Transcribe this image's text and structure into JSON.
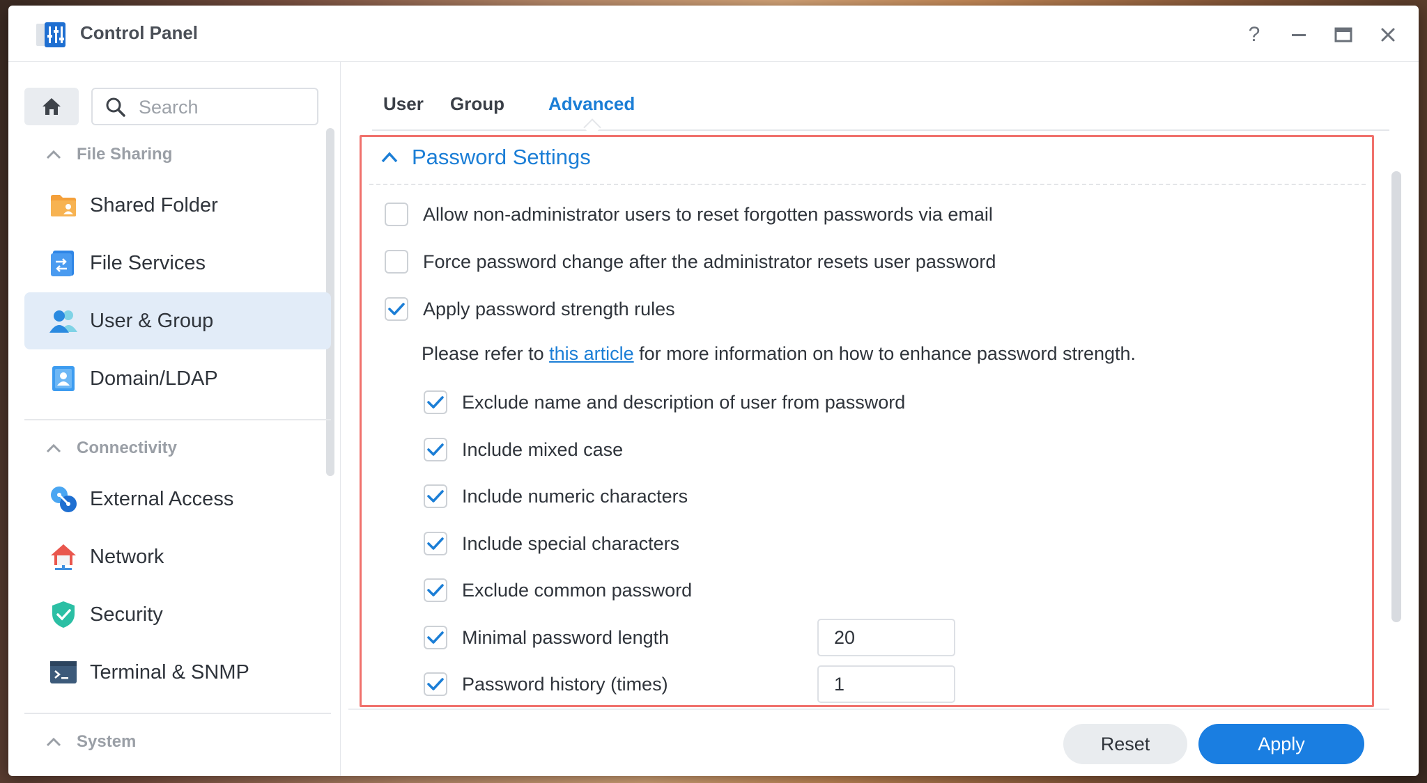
{
  "window": {
    "title": "Control Panel"
  },
  "sidebar": {
    "search_placeholder": "Search",
    "sections": [
      {
        "label": "File Sharing"
      },
      {
        "label": "Connectivity"
      },
      {
        "label": "System"
      }
    ],
    "items": [
      {
        "label": "Shared Folder",
        "icon": "folder-user-icon"
      },
      {
        "label": "File Services",
        "icon": "file-services-icon"
      },
      {
        "label": "User & Group",
        "icon": "users-icon",
        "active": true
      },
      {
        "label": "Domain/LDAP",
        "icon": "domain-icon"
      },
      {
        "label": "External Access",
        "icon": "external-access-icon"
      },
      {
        "label": "Network",
        "icon": "network-icon"
      },
      {
        "label": "Security",
        "icon": "shield-icon"
      },
      {
        "label": "Terminal & SNMP",
        "icon": "terminal-icon"
      }
    ]
  },
  "tabs": [
    {
      "label": "User"
    },
    {
      "label": "Group"
    },
    {
      "label": "Advanced",
      "active": true
    }
  ],
  "password_settings": {
    "title": "Password Settings",
    "options": [
      {
        "label": "Allow non-administrator users to reset forgotten passwords via email",
        "checked": false
      },
      {
        "label": "Force password change after the administrator resets user password",
        "checked": false
      },
      {
        "label": "Apply password strength rules",
        "checked": true
      }
    ],
    "note": {
      "prefix": "Please refer to ",
      "link": "this article",
      "suffix": " for more information on how to enhance password strength."
    },
    "rules": [
      {
        "label": "Exclude name and description of user from password",
        "checked": true
      },
      {
        "label": "Include mixed case",
        "checked": true
      },
      {
        "label": "Include numeric characters",
        "checked": true
      },
      {
        "label": "Include special characters",
        "checked": true
      },
      {
        "label": "Exclude common password",
        "checked": true
      },
      {
        "label": "Minimal password length",
        "checked": true,
        "value": "20"
      },
      {
        "label": "Password history (times)",
        "checked": true,
        "value": "1"
      }
    ]
  },
  "footer": {
    "reset_label": "Reset",
    "apply_label": "Apply"
  },
  "colors": {
    "accent": "#1b7ed6",
    "highlight_border": "#f0716c",
    "active_nav_bg": "#e2ecf8"
  }
}
